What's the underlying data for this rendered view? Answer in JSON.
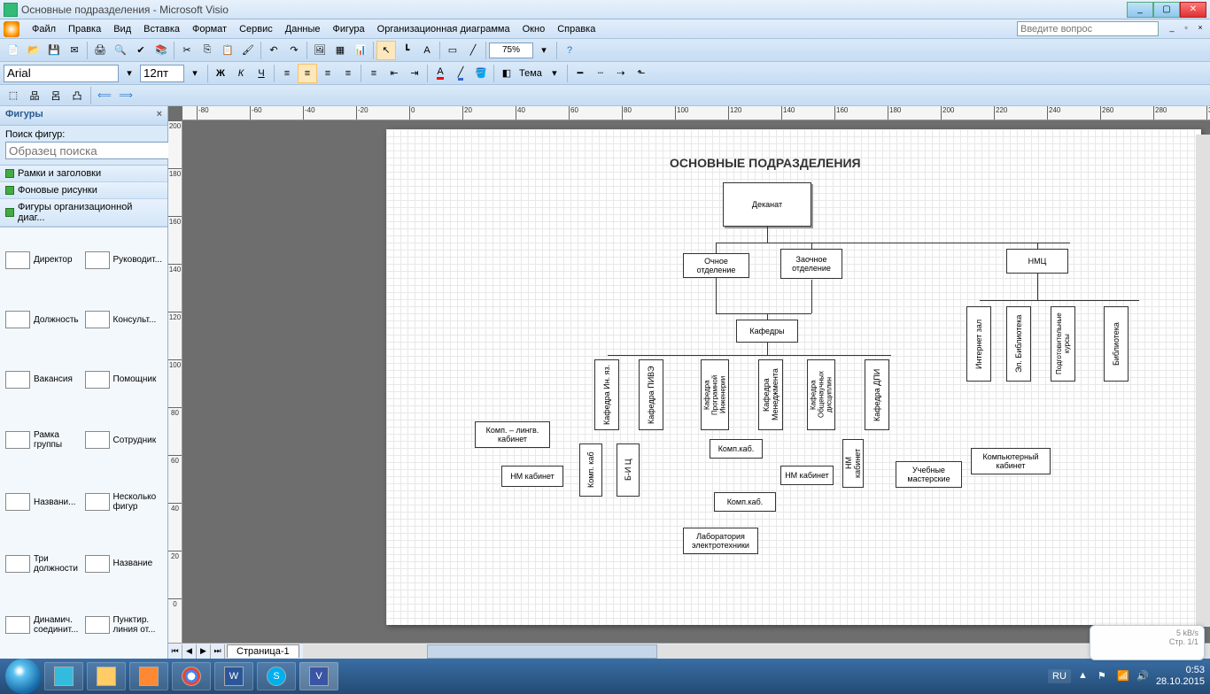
{
  "window": {
    "title": "Основные подразделения - Microsoft Visio"
  },
  "menu": {
    "items": [
      "Файл",
      "Правка",
      "Вид",
      "Вставка",
      "Формат",
      "Сервис",
      "Данные",
      "Фигура",
      "Организационная диаграмма",
      "Окно",
      "Справка"
    ],
    "help_placeholder": "Введите вопрос"
  },
  "format": {
    "font": "Arial",
    "size": "12пт",
    "zoom": "75%",
    "theme_label": "Тема"
  },
  "shapes_panel": {
    "title": "Фигуры",
    "search_label": "Поиск фигур:",
    "search_placeholder": "Образец поиска",
    "stencils": [
      "Рамки и заголовки",
      "Фоновые рисунки",
      "Фигуры организационной диаг..."
    ],
    "shapes": [
      "Директор",
      "Руководит...",
      "Должность",
      "Консульт...",
      "Вакансия",
      "Помощник",
      "Рамка группы",
      "Сотрудник",
      "Названи...",
      "Несколько фигур",
      "Три должности",
      "Название",
      "Динамич. соединит...",
      "Пунктир. линия от..."
    ]
  },
  "page_tab": "Страница-1",
  "org": {
    "title": "ОСНОВНЫЕ ПОДРАЗДЕЛЕНИЯ",
    "nodes": {
      "dekanat": "Деканат",
      "ochnoe": "Очное отделение",
      "zaochnoe": "Заочное отделение",
      "nmc": "НМЦ",
      "kafedry": "Кафедры",
      "inz": "Интернет зал",
      "elb": "Эл. Библиотека",
      "podk": "Подготовительные курсы",
      "bibl": "Библиотека",
      "kinyaz": "Кафедра Ин. яз.",
      "kpive": "Кафедра ПИВЭ",
      "kpi": "Кафедра Програмной Инженерии",
      "kmen": "Кафедра Менеджмента",
      "kond": "Кафедра Общенаучных дисциплин",
      "kdpi": "Кафедра ДПИ",
      "klk": "Комп. – лингв. кабинет",
      "nmk1": "НМ кабинет",
      "kompkab1": "Комп. каб",
      "bic": "Б-И Ц",
      "kompkab2": "Комп.каб.",
      "kompkab3": "Комп.каб.",
      "nmk2": "НМ кабинет",
      "nmk3": "НМ кабинет",
      "uchm": "Учебные мастерские",
      "kompkabinet": "Компьютерный кабинет",
      "lab": "Лаборатория электротехники"
    }
  },
  "notify": {
    "speed": "5 kB/s",
    "pages": "Стр. 1/1"
  },
  "taskbar": {
    "lang": "RU",
    "time": "0:53",
    "date": "28.10.2015"
  }
}
